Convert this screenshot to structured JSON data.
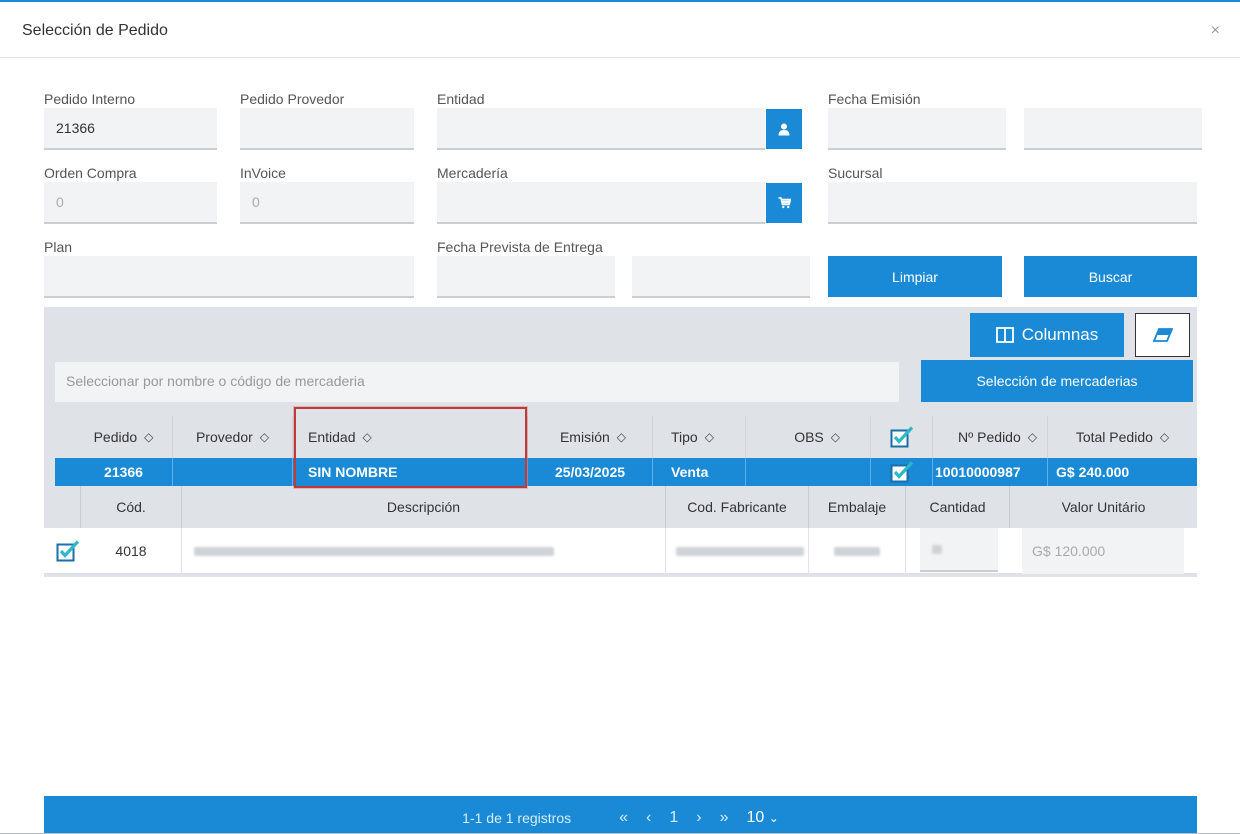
{
  "modal": {
    "title": "Selección de Pedido",
    "close": "×"
  },
  "form": {
    "pedido_interno": {
      "label": "Pedido Interno",
      "value": "21366"
    },
    "pedido_provedor": {
      "label": "Pedido Provedor",
      "value": ""
    },
    "entidad": {
      "label": "Entidad",
      "value": ""
    },
    "fecha_emision": {
      "label": "Fecha Emisión",
      "from": "",
      "to": ""
    },
    "orden_compra": {
      "label": "Orden Compra",
      "value": "0"
    },
    "invoice": {
      "label": "InVoice",
      "value": "0"
    },
    "mercaderia": {
      "label": "Mercadería",
      "value": ""
    },
    "sucursal": {
      "label": "Sucursal",
      "value": ""
    },
    "plan": {
      "label": "Plan",
      "value": ""
    },
    "fecha_prevista": {
      "label": "Fecha Prevista de Entrega",
      "from": "",
      "to": ""
    },
    "limpiar_label": "Limpiar",
    "buscar_label": "Buscar"
  },
  "grid": {
    "columnas_label": "Columnas",
    "search_placeholder": "Seleccionar por nombre o código de mercaderia",
    "seleccion_label": "Selección de mercaderias",
    "headers": {
      "pedido": "Pedido",
      "provedor": "Provedor",
      "entidad": "Entidad",
      "emision": "Emisión",
      "tipo": "Tipo",
      "obs": "OBS",
      "n_pedido": "Nº Pedido",
      "total_pedido": "Total Pedido"
    },
    "row": {
      "pedido": "21366",
      "provedor": "",
      "entidad": "SIN NOMBRE",
      "emision": "25/03/2025",
      "tipo": "Venta",
      "obs": "",
      "n_pedido": "10010000987",
      "total_pedido": "G$ 240.000"
    },
    "detail_headers": {
      "cod": "Cód.",
      "descripcion": "Descripción",
      "cod_fabricante": "Cod. Fabricante",
      "embalaje": "Embalaje",
      "cantidad": "Cantidad",
      "valor_unitario": "Valor Unitário"
    },
    "detail_row": {
      "cod": "4018",
      "valor_unitario": "G$ 120.000"
    }
  },
  "pager": {
    "summary": "1-1 de 1 registros",
    "first": "«",
    "prev": "‹",
    "page": "1",
    "next": "›",
    "last": "»",
    "page_size": "10"
  },
  "colors": {
    "accent": "#1a8ad6",
    "highlight": "#c0393b"
  }
}
